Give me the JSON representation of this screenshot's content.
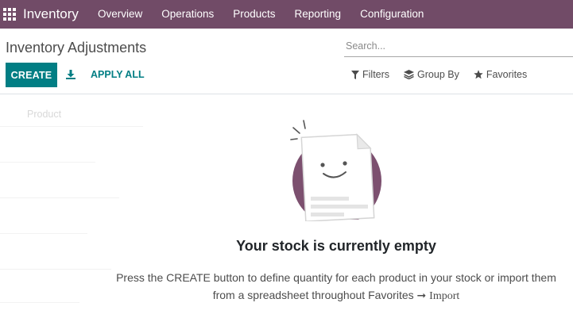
{
  "app": {
    "name": "Inventory"
  },
  "nav": {
    "items": [
      {
        "label": "Overview"
      },
      {
        "label": "Operations"
      },
      {
        "label": "Products"
      },
      {
        "label": "Reporting"
      },
      {
        "label": "Configuration"
      }
    ]
  },
  "control_panel": {
    "breadcrumb": "Inventory Adjustments",
    "search_placeholder": "Search...",
    "create_label": "CREATE",
    "apply_all_label": "APPLY ALL",
    "filters_label": "Filters",
    "group_by_label": "Group By",
    "favorites_label": "Favorites"
  },
  "list": {
    "column_header": "Product"
  },
  "helper": {
    "title": "Your stock is currently empty",
    "line1": "Press the CREATE button to define quantity for each product in your stock or import them",
    "line2": "from a spreadsheet throughout Favorites",
    "arrow": "➞",
    "import": "Import"
  },
  "colors": {
    "brand": "#714b67",
    "primary": "#017e84"
  }
}
